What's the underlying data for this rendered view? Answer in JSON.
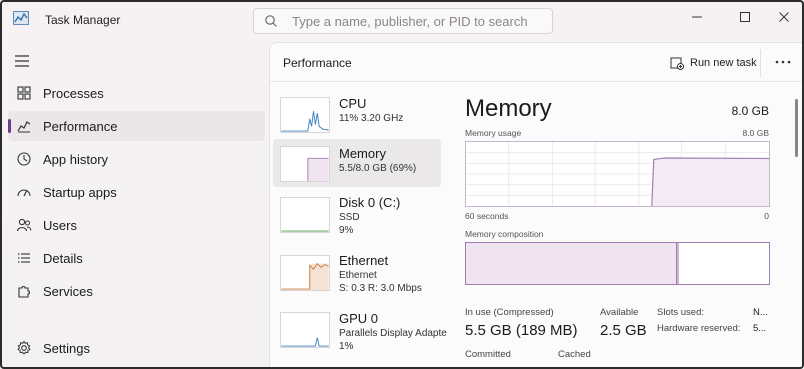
{
  "app": {
    "title": "Task Manager",
    "search_placeholder": "Type a name, publisher, or PID to search"
  },
  "sidebar": {
    "items": [
      {
        "label": "Processes",
        "icon": "processes-grid-icon"
      },
      {
        "label": "Performance",
        "icon": "performance-chart-icon",
        "active": true
      },
      {
        "label": "App history",
        "icon": "history-clock-icon"
      },
      {
        "label": "Startup apps",
        "icon": "startup-gauge-icon"
      },
      {
        "label": "Users",
        "icon": "users-icon"
      },
      {
        "label": "Details",
        "icon": "details-list-icon"
      },
      {
        "label": "Services",
        "icon": "services-puzzle-icon"
      }
    ],
    "settings_label": "Settings"
  },
  "header": {
    "page_title": "Performance",
    "run_new_task": "Run new task"
  },
  "devices": [
    {
      "name": "CPU",
      "sub1": "11%  3.20 GHz",
      "sub2": ""
    },
    {
      "name": "Memory",
      "sub1": "5.5/8.0 GB (69%)",
      "sub2": "",
      "selected": true
    },
    {
      "name": "Disk 0 (C:)",
      "sub1": "SSD",
      "sub2": "9%"
    },
    {
      "name": "Ethernet",
      "sub1": "Ethernet",
      "sub2": "S: 0.3  R: 3.0 Mbps"
    },
    {
      "name": "GPU 0",
      "sub1": "Parallels Display Adapte",
      "sub2": "1%"
    }
  ],
  "detail": {
    "title": "Memory",
    "total": "8.0 GB",
    "usage_label": "Memory usage",
    "usage_max": "8.0 GB",
    "time_label": "60 seconds",
    "time_min": "0",
    "composition_label": "Memory composition",
    "composition_in_use_fraction": 0.69,
    "stats": {
      "in_use_label": "In use (Compressed)",
      "in_use_value": "5.5 GB (189 MB)",
      "available_label": "Available",
      "available_value": "2.5 GB",
      "committed_label": "Committed",
      "cached_label": "Cached",
      "slots_label": "Slots used:",
      "slots_value": "N...",
      "hw_reserved_label": "Hardware reserved:",
      "hw_reserved_value": "5..."
    }
  },
  "colors": {
    "accent": "#6b3d91",
    "memory_line": "#9f7fb0",
    "memory_fill": "#efe4f0",
    "cpu_line": "#3c7fbf",
    "ethernet_line": "#c87a3a"
  }
}
